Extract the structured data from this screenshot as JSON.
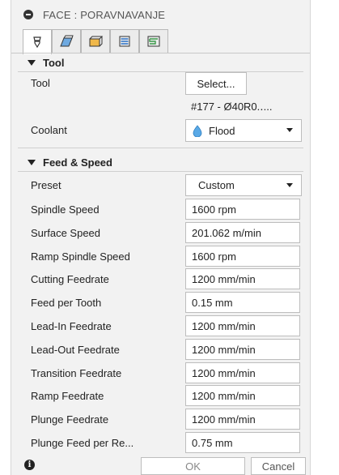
{
  "window": {
    "title": "FACE : PORAVNAVANJE"
  },
  "tabs": [
    {
      "icon": "tool-icon"
    },
    {
      "icon": "geometry-icon"
    },
    {
      "icon": "heights-icon"
    },
    {
      "icon": "passes-icon"
    },
    {
      "icon": "linking-icon"
    }
  ],
  "tool_section": {
    "title": "Tool",
    "tool_label": "Tool",
    "select_button": "Select...",
    "tool_name": "#177 - Ø40R0.․...",
    "coolant_label": "Coolant",
    "coolant_value": "Flood"
  },
  "feed_section": {
    "title": "Feed & Speed",
    "preset_label": "Preset",
    "preset_value": "Custom",
    "rows": [
      {
        "label": "Spindle Speed",
        "value": "1600 rpm"
      },
      {
        "label": "Surface Speed",
        "value": "201.062 m/min"
      },
      {
        "label": "Ramp Spindle Speed",
        "value": "1600 rpm"
      },
      {
        "label": "Cutting Feedrate",
        "value": "1200 mm/min"
      },
      {
        "label": "Feed per Tooth",
        "value": "0.15 mm"
      },
      {
        "label": "Lead-In Feedrate",
        "value": "1200 mm/min"
      },
      {
        "label": "Lead-Out Feedrate",
        "value": "1200 mm/min"
      },
      {
        "label": "Transition Feedrate",
        "value": "1200 mm/min"
      },
      {
        "label": "Ramp Feedrate",
        "value": "1200 mm/min"
      },
      {
        "label": "Plunge Feedrate",
        "value": "1200 mm/min"
      },
      {
        "label": "Plunge Feed per Re...",
        "value": "0.75 mm"
      }
    ]
  },
  "footer": {
    "ok_label": "OK",
    "cancel_label": "Cancel"
  },
  "colors": {
    "panel_bg": "#f2f2f2",
    "flood_drop": "#5aa9e6"
  }
}
